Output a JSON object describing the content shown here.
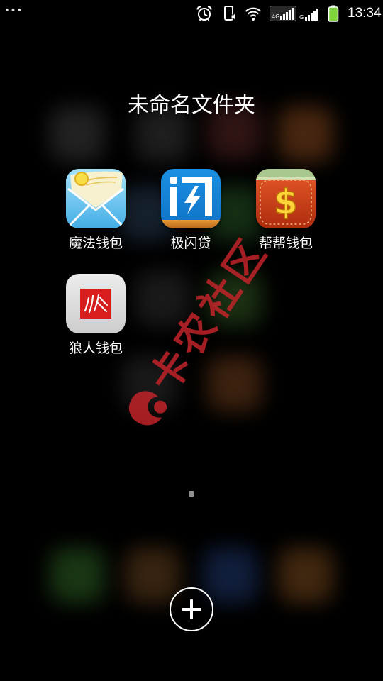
{
  "status_bar": {
    "menu_dots": "•••",
    "icons": [
      "alarm-icon",
      "phone-vibrate-icon",
      "wifi-icon",
      "signal-4g-icon",
      "signal-g-icon",
      "battery-icon"
    ],
    "network_4g_label": "4G",
    "network_g_label": "G",
    "battery_color": "#7ed33a",
    "time": "13:34"
  },
  "folder": {
    "title": "未命名文件夹",
    "apps": [
      {
        "label": "魔法钱包",
        "icon": "magic-wallet-app-icon"
      },
      {
        "label": "极闪贷",
        "icon": "jishandai-app-icon"
      },
      {
        "label": "帮帮钱包",
        "icon": "bangbang-wallet-app-icon",
        "glyph": "$"
      },
      {
        "label": "狼人钱包",
        "icon": "wolf-wallet-app-icon"
      }
    ]
  },
  "add_button": {
    "icon": "plus-icon"
  },
  "watermark": {
    "text": "卡农社区",
    "color": "#c8242b"
  }
}
